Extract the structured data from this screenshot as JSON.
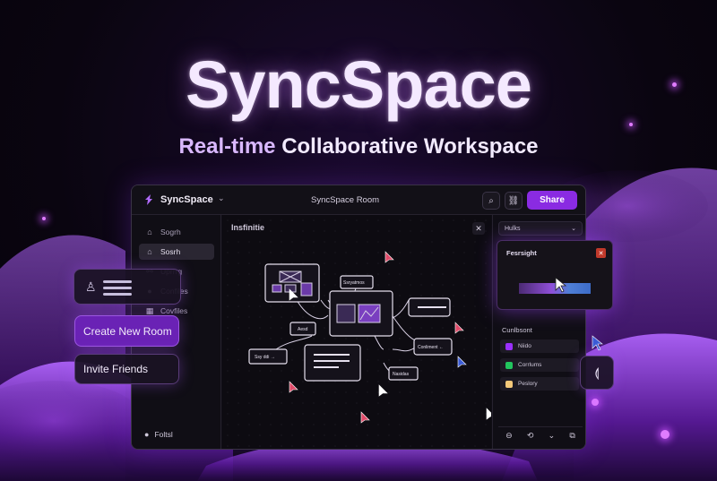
{
  "hero": {
    "title": "SyncSpace",
    "subtitle_accent": "Real-time",
    "subtitle_rest": "Collaborative Workspace"
  },
  "app": {
    "name": "SyncSpace",
    "room_title": "SyncSpace Room",
    "share_label": "Share",
    "icons": [
      "search-icon",
      "link-icon"
    ]
  },
  "sidebar": {
    "items": [
      {
        "label": "Sogrh",
        "icon": "home-icon"
      },
      {
        "label": "Sosrh",
        "icon": "lock-icon",
        "active": true
      },
      {
        "label": "Uprrrg",
        "icon": "connections-icon"
      },
      {
        "label": "Confiles",
        "icon": "user-icon"
      },
      {
        "label": "Covfiles",
        "icon": "grid-icon"
      }
    ],
    "footer": "Foltsl"
  },
  "canvas": {
    "label": "Insfinitie",
    "nodes": [
      "Ssryatmos",
      "Aesd",
      "Ssy ddi →",
      "Conliment ←",
      "Nasidas"
    ],
    "tools": [
      "pen-icon",
      "shapes-icon",
      "frame-icon",
      "curve-icon",
      "import-icon",
      "triangle-icon",
      "note-icon",
      "link-icon",
      "add-icon"
    ],
    "add_label": "+"
  },
  "right_panel": {
    "layer_label": "Hulks",
    "section_title": "Cunlbsont",
    "colors": [
      {
        "label": "Niido",
        "color": "#9b30ff"
      },
      {
        "label": "Corrlums",
        "color": "#22c55e"
      },
      {
        "label": "Peslory",
        "color": "#f5c97a"
      }
    ]
  },
  "popup": {
    "title": "Fesrsight",
    "close": "✕"
  },
  "floating": {
    "create_room": "Create New Room",
    "invite": "Invite Friends"
  },
  "colors": {
    "accent": "#8a2be2",
    "background": "#0a0510"
  }
}
